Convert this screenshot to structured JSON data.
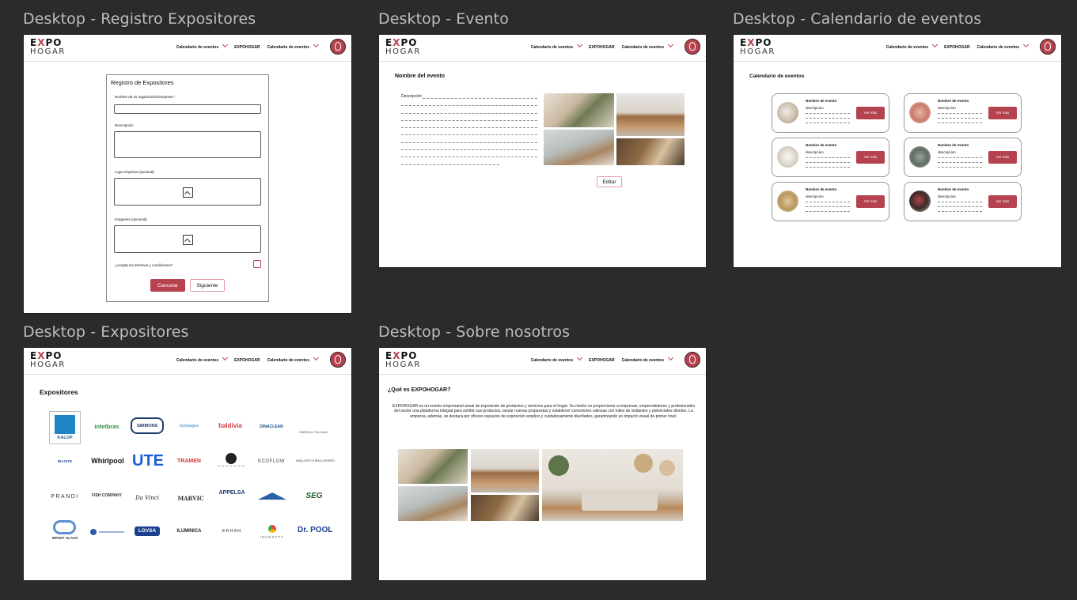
{
  "frames": [
    {
      "id": "registro",
      "title": "Desktop - Registro Expositores"
    },
    {
      "id": "evento",
      "title": "Desktop - Evento"
    },
    {
      "id": "calendario",
      "title": "Desktop - Calendario de eventos"
    },
    {
      "id": "expositores",
      "title": "Desktop - Expositores"
    },
    {
      "id": "sobre",
      "title": "Desktop - Sobre nosotros"
    }
  ],
  "header": {
    "logo_top_left": "E",
    "logo_top_x": "X",
    "logo_top_right": "PO",
    "logo_bottom": "HOGAR",
    "nav_calendar": "Calendario de eventos",
    "nav_expohogar": "EXPOHOGAR",
    "nav_calendar_2": "Calendario de eventos",
    "avatar_icon": "user-circle-icon"
  },
  "registro": {
    "title": "Registro de Expositores",
    "org_label": "Nombre de su organización/empresa",
    "required_mark": "*",
    "desc_label": "Descripción",
    "logo_label": "Logo empresa (opcional)",
    "images_label": "Imagenes (opcional)",
    "terms_label": "¿Acepta los terminos y condiciones?",
    "cancel": "Cancelar",
    "next": "Siguiente"
  },
  "evento": {
    "title": "Nombre del evento",
    "desc_label": "Descripción",
    "edit": "Editar"
  },
  "calendario": {
    "title": "Calendario de eventos",
    "cards": [
      {
        "name": "Nombre de evento",
        "desc": "descripcion",
        "button": "Ver más"
      },
      {
        "name": "Nombre de evento",
        "desc": "descripcion",
        "button": "Ver más"
      },
      {
        "name": "Nombre de evento",
        "desc": "descripcion",
        "button": "Ver más"
      },
      {
        "name": "Nombre de evento",
        "desc": "descripcion",
        "button": "Ver más"
      },
      {
        "name": "Nombre de evento",
        "desc": "descripcion",
        "button": "Ver más"
      },
      {
        "name": "Nombre de evento",
        "desc": "descripcion",
        "button": "Ver más"
      }
    ]
  },
  "expositores": {
    "title": "Expositores",
    "brands": [
      "KALOP",
      "intelbras",
      "SIMMONS",
      "fundaagua",
      "baldivia",
      "DINACLEAN",
      "FABRICA ITALIANA",
      "BIAGITE",
      "Whirlpool",
      "UTE",
      "TRAMEN",
      "",
      "ECOFLOW",
      "ARQUITECTURA & DISEÑO",
      "PRANDI",
      "FISH COMPANY",
      "Da Vinci",
      "MARVIC",
      "APPELSA",
      "",
      "SEG",
      "INFINIT GLASS",
      "",
      "LOVSA",
      "ILUMINICA",
      "ERHAN",
      "INVESTTY",
      "Dr. POOL"
    ]
  },
  "sobre": {
    "title": "¿Qué es EXPOHOGAR?",
    "text": "EXPOHOGAR es un evento empresarial anual de exposición de productos y servicios para el hogar. Su misión es proporcionar a empresas, emprendedores y profesionales del sector una plataforma integral para exhibir sus productos, lanzar nuevas propuestas y establecer conexiones valiosas con miles de visitantes y potenciales clientes. La empresa, además, se destaca por ofrecer espacios de exposición amplios y cuidadosamente diseñados, garantizando un impacto visual de primer nivel."
  },
  "colors": {
    "accent": "#b5424e",
    "canvas": "#2b2b2b"
  }
}
